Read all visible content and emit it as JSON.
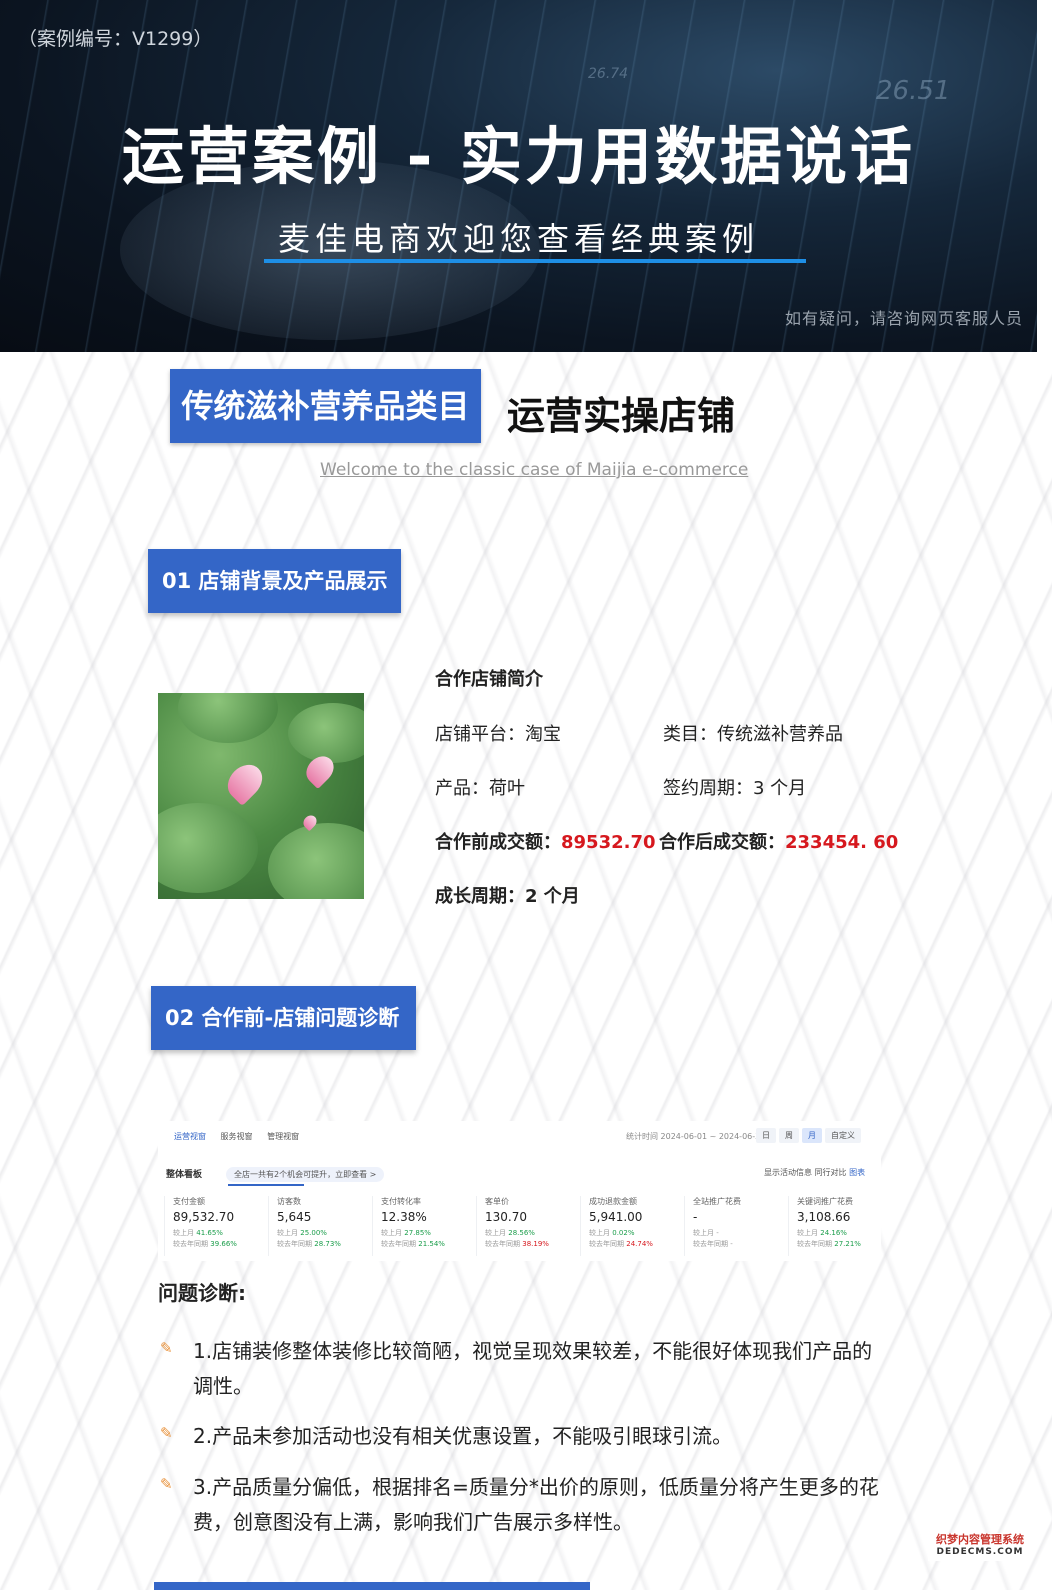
{
  "hero": {
    "case_no": "（案例编号：V1299）",
    "title": "运营案例 - 实力用数据说话",
    "subtitle": "麦佳电商欢迎您查看经典案例",
    "note": "如有疑问，请咨询网页客服人员",
    "deco_numbers": [
      "26.51",
      "26.74"
    ]
  },
  "category": {
    "label": "传统滋补营养品类目",
    "text": "运营实操店铺",
    "welcome": "Welcome to the classic case of Maijia e-commerce"
  },
  "section1": {
    "heading": "01 店铺背景及产品展示",
    "info_title": "合作店铺简介",
    "platform": "店铺平台：淘宝",
    "category": "类目：传统滋补营养品",
    "product": "产品：荷叶",
    "period": "签约周期：3 个月",
    "before_label": "合作前成交额：",
    "before_value": "89532.70",
    "after_label": "合作后成交额：",
    "after_value": "233454. 60",
    "growth": "成长周期：2 个月"
  },
  "section2": {
    "heading": "02 合作前-店铺问题诊断",
    "dashboard": {
      "tabs": [
        "运营视窗",
        "服务视窗",
        "管理视窗"
      ],
      "period": "统计时间 2024-06-01 ~ 2024-06-30",
      "period_buttons": [
        "日",
        "周",
        "月",
        "自定义"
      ],
      "board_title": "整体看板",
      "tip": "全店一共有2个机会可提升，立即查看 >",
      "options": [
        "显示活动信息",
        "同行对比",
        "图表"
      ],
      "metrics": [
        {
          "label": "支付金额",
          "value": "89,532.70",
          "c1_label": "较上月",
          "c1": "41.65%",
          "c2_label": "较去年同期",
          "c2": "39.66%"
        },
        {
          "label": "访客数",
          "value": "5,645",
          "c1_label": "较上月",
          "c1": "25.00%",
          "c2_label": "较去年同期",
          "c2": "28.73%"
        },
        {
          "label": "支付转化率",
          "value": "12.38%",
          "c1_label": "较上月",
          "c1": "27.85%",
          "c2_label": "较去年同期",
          "c2": "21.54%"
        },
        {
          "label": "客单价",
          "value": "130.70",
          "c1_label": "较上月",
          "c1": "28.56%",
          "c2_label": "较去年同期",
          "c2": "38.19%"
        },
        {
          "label": "成功退款金额",
          "value": "5,941.00",
          "c1_label": "较上月",
          "c1": "0.02%",
          "c2_label": "较去年同期",
          "c2": "24.74%"
        },
        {
          "label": "全站推广花费",
          "value": "-",
          "c1_label": "较上月",
          "c1": "-",
          "c2_label": "较去年同期",
          "c2": "-"
        },
        {
          "label": "关键词推广花费",
          "value": "3,108.66",
          "c1_label": "较上月",
          "c1": "24.16%",
          "c2_label": "较去年同期",
          "c2": "27.21%"
        }
      ]
    },
    "diag_title": "问题诊断:",
    "items": [
      "1.店铺装修整体装修比较简陋，视觉呈现效果较差，不能很好体现我们产品的调性。",
      "2.产品未参加活动也没有相关优惠设置，不能吸引眼球引流。",
      "3.产品质量分偏低，根据排名=质量分*出价的原则，低质量分将产生更多的花费，创意图没有上满，影响我们广告展示多样性。"
    ]
  },
  "watermark": {
    "line1": "织梦内容管理系统",
    "line2": "DEDECMS.COM"
  },
  "colors": {
    "accent": "#3466c7",
    "highlight": "#d6181e",
    "hero_bar": "#1e8fe6"
  }
}
